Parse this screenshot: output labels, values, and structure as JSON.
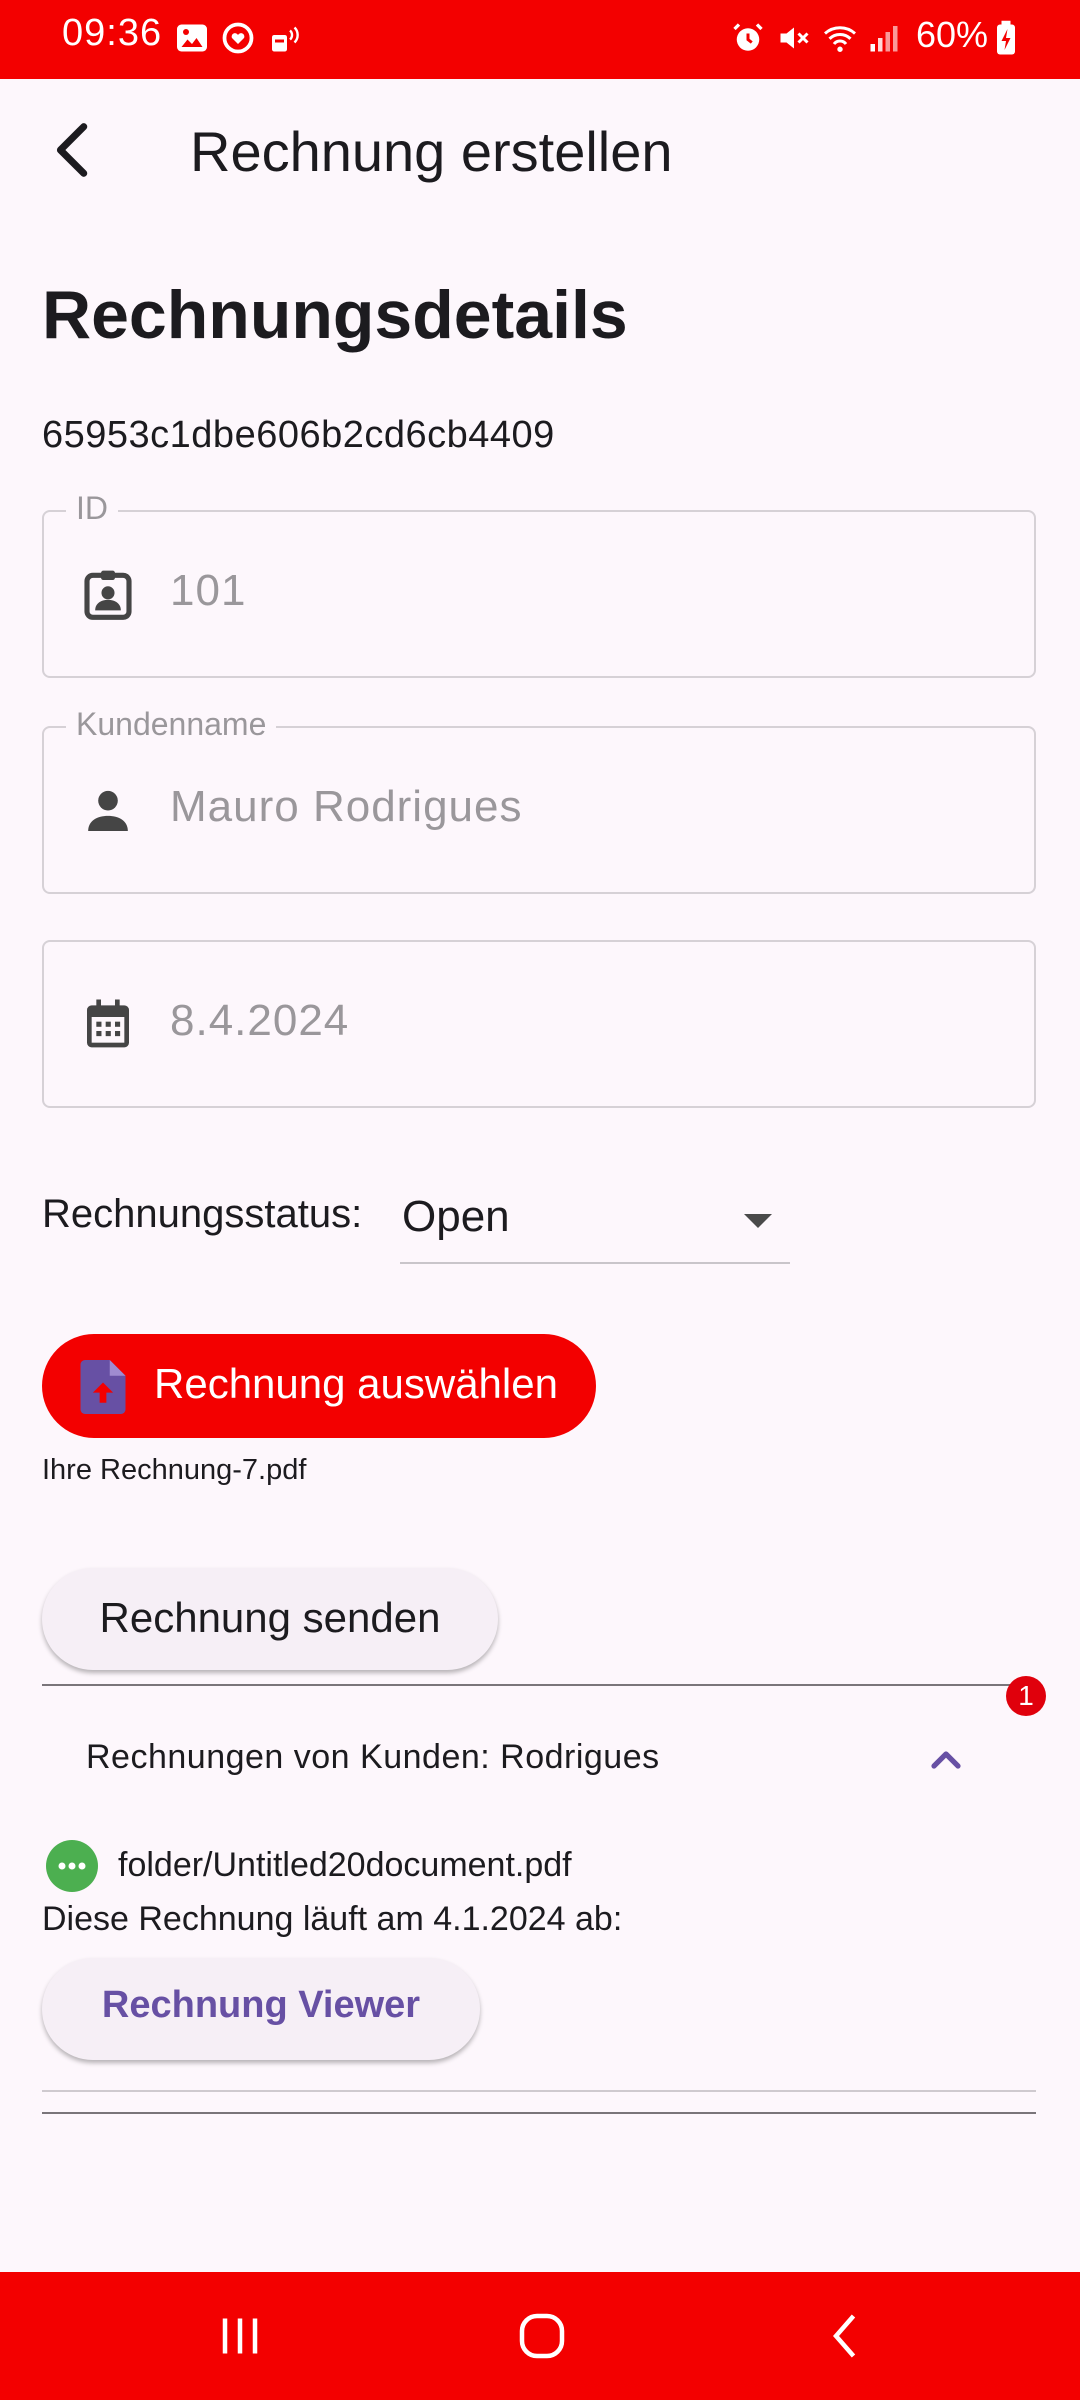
{
  "status_bar": {
    "time": "09:36",
    "battery": "60%"
  },
  "app_bar": {
    "title": "Rechnung erstellen"
  },
  "section": {
    "title": "Rechnungsdetails",
    "object_id": "65953c1dbe606b2cd6cb4409"
  },
  "fields": {
    "id": {
      "label": "ID",
      "value": "101"
    },
    "customer": {
      "label": "Kundenname",
      "value": "Mauro Rodrigues"
    },
    "date": {
      "value": "8.4.2024"
    }
  },
  "invoice_status": {
    "label": "Rechnungsstatus:",
    "selected": "Open"
  },
  "pick_button": {
    "label": "Rechnung auswählen",
    "file_name": "Ihre Rechnung-7.pdf"
  },
  "send_button": {
    "label": "Rechnung senden"
  },
  "customer_invoices": {
    "badge_count": "1",
    "title": "Rechnungen von Kunden: Rodrigues",
    "items": [
      {
        "path": "folder/Untitled20document.pdf",
        "expiry": "Diese Rechnung läuft am 4.1.2024 ab:",
        "viewer_label": "Rechnung Viewer"
      }
    ]
  },
  "colors": {
    "brand": "#f30000",
    "accent": "#6750a4",
    "status_icon_green": "#4caf50"
  }
}
